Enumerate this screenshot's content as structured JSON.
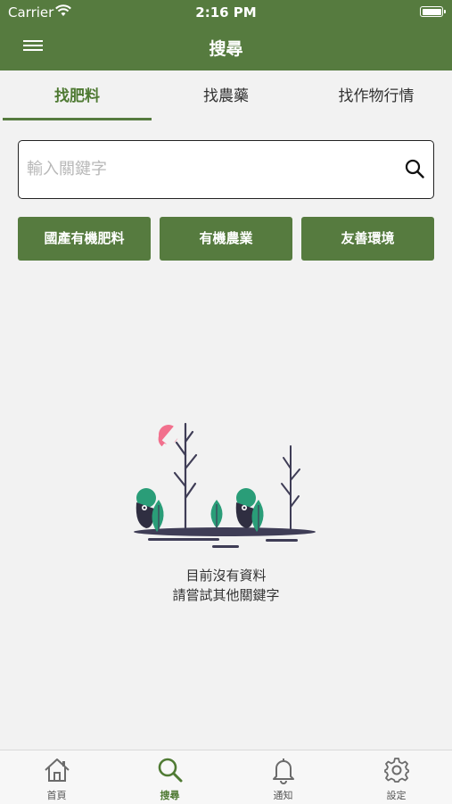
{
  "status_bar": {
    "carrier": "Carrier",
    "time": "2:16 PM"
  },
  "nav": {
    "title": "搜尋",
    "menu_icon": "hamburger-icon"
  },
  "tabs": [
    {
      "label": "找肥料",
      "active": true
    },
    {
      "label": "找農藥",
      "active": false
    },
    {
      "label": "找作物行情",
      "active": false
    }
  ],
  "search": {
    "placeholder": "輸入關鍵字",
    "value": ""
  },
  "chips": [
    {
      "label": "國產有機肥料"
    },
    {
      "label": "有機農業"
    },
    {
      "label": "友善環境"
    }
  ],
  "empty_state": {
    "line1": "目前沒有資料",
    "line2": "請嘗試其他關鍵字"
  },
  "tab_bar": [
    {
      "label": "首頁",
      "icon": "home-icon",
      "active": false
    },
    {
      "label": "搜尋",
      "icon": "search-icon",
      "active": true
    },
    {
      "label": "通知",
      "icon": "bell-icon",
      "active": false
    },
    {
      "label": "設定",
      "icon": "gear-icon",
      "active": false
    }
  ],
  "colors": {
    "primary": "#567b3f",
    "accent_text": "#4f7a33",
    "background": "#f2f2f2"
  }
}
